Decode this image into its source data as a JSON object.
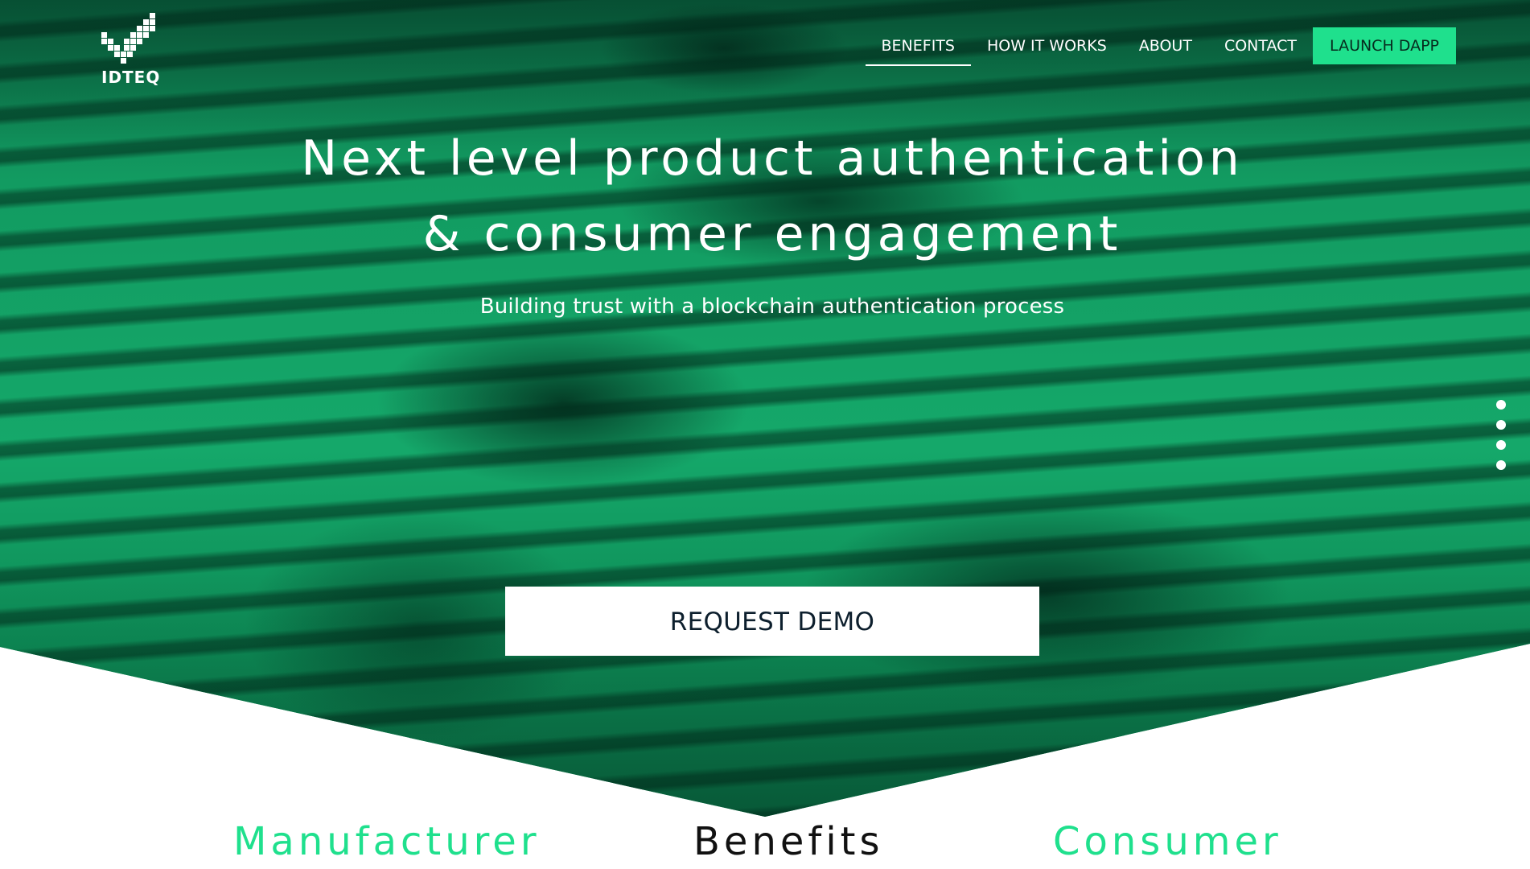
{
  "brand": {
    "name": "IDTEQ",
    "logo_icon": "pixel-checkmark-icon"
  },
  "nav": {
    "items": [
      {
        "label": "BENEFITS",
        "active": true
      },
      {
        "label": "HOW IT WORKS",
        "active": false
      },
      {
        "label": "ABOUT",
        "active": false
      },
      {
        "label": "CONTACT",
        "active": false
      }
    ],
    "cta_label": "LAUNCH DAPP"
  },
  "hero": {
    "headline_line1": "Next level product authentication",
    "headline_line2": "& consumer engagement",
    "subheadline": "Building trust with a blockchain authentication process",
    "demo_button_label": "REQUEST DEMO",
    "slide_count": 4
  },
  "sections": {
    "manufacturer_heading": "Manufacturer",
    "benefits_heading": "Benefits",
    "consumer_heading": "Consumer"
  },
  "colors": {
    "accent": "#1fe08d",
    "hero_green": "#0f9d63",
    "heading_dark": "#111111",
    "button_text": "#0d1f2d"
  }
}
